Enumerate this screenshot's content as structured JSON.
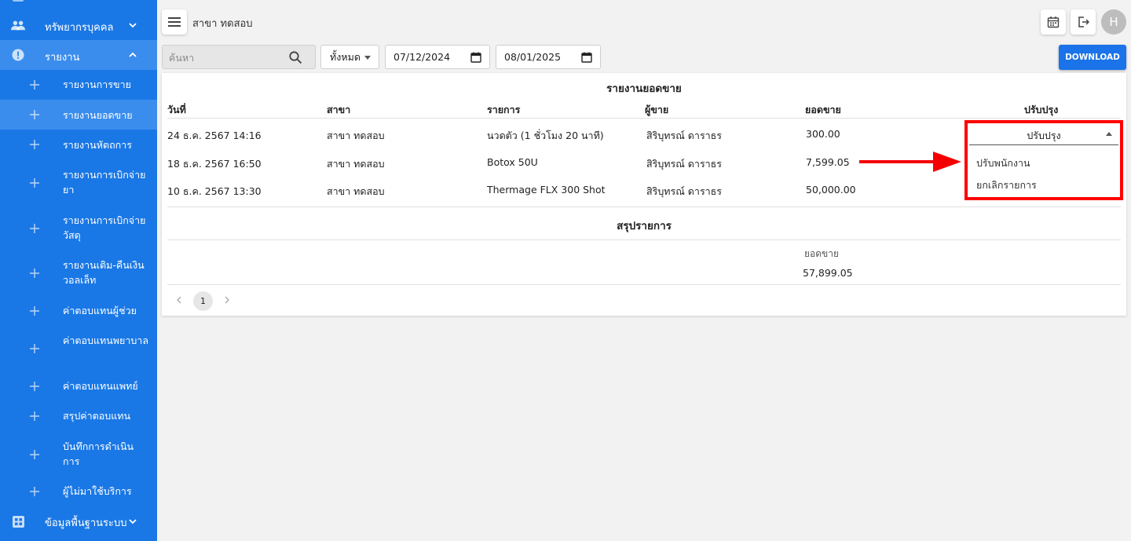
{
  "sidebar": {
    "sections": [
      {
        "label": "ทรัพยากรบุคคล",
        "icon": "people-icon",
        "expanded": false
      },
      {
        "label": "รายงาน",
        "icon": "alert-circle-icon",
        "expanded": true
      },
      {
        "label": "ข้อมูลพื้นฐานระบบ",
        "icon": "grid-icon",
        "expanded": false
      }
    ],
    "report_items": [
      {
        "label": "รายงานการขาย"
      },
      {
        "label": "รายงานยอดขาย",
        "active": true
      },
      {
        "label": "รายงานหัตถการ"
      },
      {
        "label": "รายงานการเบิกจ่ายยา"
      },
      {
        "label": "รายงานการเบิกจ่ายวัสดุ"
      },
      {
        "label": "รายงานเติม-คืนเงินวอลเล็ท"
      },
      {
        "label": "ค่าตอบแทนผู้ช่วย"
      },
      {
        "label": "ค่าตอบแทนพยาบาล"
      },
      {
        "label": "ค่าตอบแทนแพทย์"
      },
      {
        "label": "สรุปค่าตอบแทน"
      },
      {
        "label": "บันทึกการดำเนินการ"
      },
      {
        "label": "ผู้ไม่มาใช้บริการ"
      }
    ],
    "colors": {
      "background": "#1a78e6",
      "active": "#3b8ded"
    }
  },
  "header": {
    "branch": "สาขา ทดสอบ",
    "avatar_initial": "H"
  },
  "filters": {
    "search_placeholder": "ค้นหา",
    "status_select": "ทั้งหมด",
    "date_from": "07/12/2024",
    "date_to": "08/01/2025",
    "download_label": "DOWNLOAD"
  },
  "report": {
    "title": "รายงานยอดขาย",
    "columns": [
      "วันที่",
      "สาขา",
      "รายการ",
      "ผู้ขาย",
      "ยอดขาย",
      "ปรับปรุง"
    ],
    "rows": [
      {
        "date": "24 ธ.ค. 2567 14:16",
        "branch": "สาขา ทดสอบ",
        "item": "นวดตัว (1 ชั่วโมง 20 นาที)",
        "seller": "สิริบุทรณ์ ดาราธร",
        "amount": "300.00",
        "action": "ปรับปรุง"
      },
      {
        "date": "18 ธ.ค. 2567 16:50",
        "branch": "สาขา ทดสอบ",
        "item": "Botox 50U",
        "seller": "สิริบุทรณ์ ดาราธร",
        "amount": "7,599.05"
      },
      {
        "date": "10 ธ.ค. 2567 13:30",
        "branch": "สาขา ทดสอบ",
        "item": "Thermage FLX 300 Shot",
        "seller": "สิริบุทรณ์ ดาราธร",
        "amount": "50,000.00"
      }
    ],
    "summary_title": "สรุปรายการ",
    "summary_label": "ยอดขาย",
    "summary_value": "57,899.05",
    "current_page": "1"
  },
  "dropdown": {
    "selected": "ปรับปรุง",
    "options": [
      "ปรับพนักงาน",
      "ยกเลิกรายการ"
    ],
    "highlight_color": "#ff0000"
  }
}
